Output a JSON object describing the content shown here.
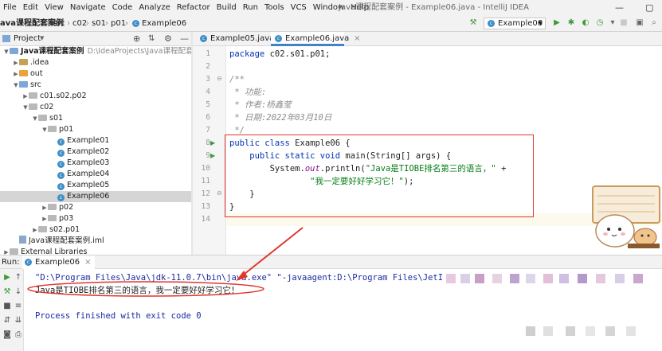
{
  "menubar": {
    "items": [
      "File",
      "Edit",
      "View",
      "Navigate",
      "Code",
      "Analyze",
      "Refactor",
      "Build",
      "Run",
      "Tools",
      "VCS",
      "Window",
      "Help"
    ],
    "window_title": "Java课程配套案例 - Example06.java - IntelliJ IDEA",
    "minimize": "—",
    "maximize": "▢"
  },
  "navbar": {
    "crumbs": [
      "ava课程配套案例",
      "src",
      "c02",
      "s01",
      "p01",
      "Example06"
    ],
    "run_config": "Example06"
  },
  "project": {
    "title": "Project",
    "tree": [
      {
        "depth": 0,
        "arrow": "▼",
        "icon": "folder-blue",
        "label": "Java课程配套案例",
        "extra": "D:\\IdeaProjects\\Java课程配套案例"
      },
      {
        "depth": 1,
        "arrow": "▶",
        "icon": "folder",
        "label": ".idea"
      },
      {
        "depth": 1,
        "arrow": "▶",
        "icon": "folder-orange",
        "label": "out"
      },
      {
        "depth": 1,
        "arrow": "▼",
        "icon": "folder-blue",
        "label": "src"
      },
      {
        "depth": 2,
        "arrow": "▶",
        "icon": "pkg",
        "label": "c01.s02.p02"
      },
      {
        "depth": 2,
        "arrow": "▼",
        "icon": "pkg",
        "label": "c02"
      },
      {
        "depth": 3,
        "arrow": "▼",
        "icon": "pkg",
        "label": "s01"
      },
      {
        "depth": 4,
        "arrow": "▼",
        "icon": "pkg",
        "label": "p01"
      },
      {
        "depth": 5,
        "arrow": "",
        "icon": "class",
        "label": "Example01"
      },
      {
        "depth": 5,
        "arrow": "",
        "icon": "class",
        "label": "Example02"
      },
      {
        "depth": 5,
        "arrow": "",
        "icon": "class",
        "label": "Example03"
      },
      {
        "depth": 5,
        "arrow": "",
        "icon": "class",
        "label": "Example04"
      },
      {
        "depth": 5,
        "arrow": "",
        "icon": "class",
        "label": "Example05"
      },
      {
        "depth": 5,
        "arrow": "",
        "icon": "class",
        "label": "Example06",
        "selected": true
      },
      {
        "depth": 4,
        "arrow": "▶",
        "icon": "pkg",
        "label": "p02"
      },
      {
        "depth": 4,
        "arrow": "▶",
        "icon": "pkg",
        "label": "p03"
      },
      {
        "depth": 3,
        "arrow": "▶",
        "icon": "pkg",
        "label": "s02.p01"
      },
      {
        "depth": 1,
        "arrow": "",
        "icon": "iml",
        "label": "Java课程配套案例.iml"
      },
      {
        "depth": 0,
        "arrow": "▶",
        "icon": "lib",
        "label": "External Libraries"
      }
    ]
  },
  "editor": {
    "tabs": [
      {
        "label": "Example05.java",
        "active": false
      },
      {
        "label": "Example06.java",
        "active": true
      }
    ],
    "line_numbers": [
      "1",
      "2",
      "3",
      "4",
      "5",
      "6",
      "7",
      "8",
      "9",
      "10",
      "11",
      "12",
      "13",
      "14"
    ],
    "code": {
      "l1_kw": "package",
      "l1_rest": " c02.s01.p01;",
      "l3": "/**",
      "l4": " * 功能:",
      "l5": " * 作者:杨鑫莹",
      "l6": " * 日期:2022年03月10日",
      "l7": " */",
      "l8_kw": "public class",
      "l8_rest": " Example06 {",
      "l9_kw": "    public static void",
      "l9_rest": " main(String[] args) {",
      "l10_a": "        System.",
      "l10_out": "out",
      "l10_b": ".println(",
      "l10_str": "\"Java是TIOBE排名第三的语言，\"",
      "l10_c": " +",
      "l11_str": "                \"我一定要好好学习它！\"",
      "l11_c": ");",
      "l12": "    }",
      "l13": "}"
    }
  },
  "run_panel": {
    "label": "Run:",
    "tab": "Example06",
    "cmd_line": "\"D:\\Program Files\\Java\\jdk-11.0.7\\bin\\java.exe\" \"-javaagent:D:\\Program Files\\JetI",
    "output_line": "Java是TIOBE排名第三的语言，我一定要好好学习它！",
    "exit_line": "Process finished with exit code 0"
  },
  "colors": {
    "annotation_red": "#e0362d",
    "accent_blue": "#4083c9",
    "run_green": "#3c9a3c"
  }
}
